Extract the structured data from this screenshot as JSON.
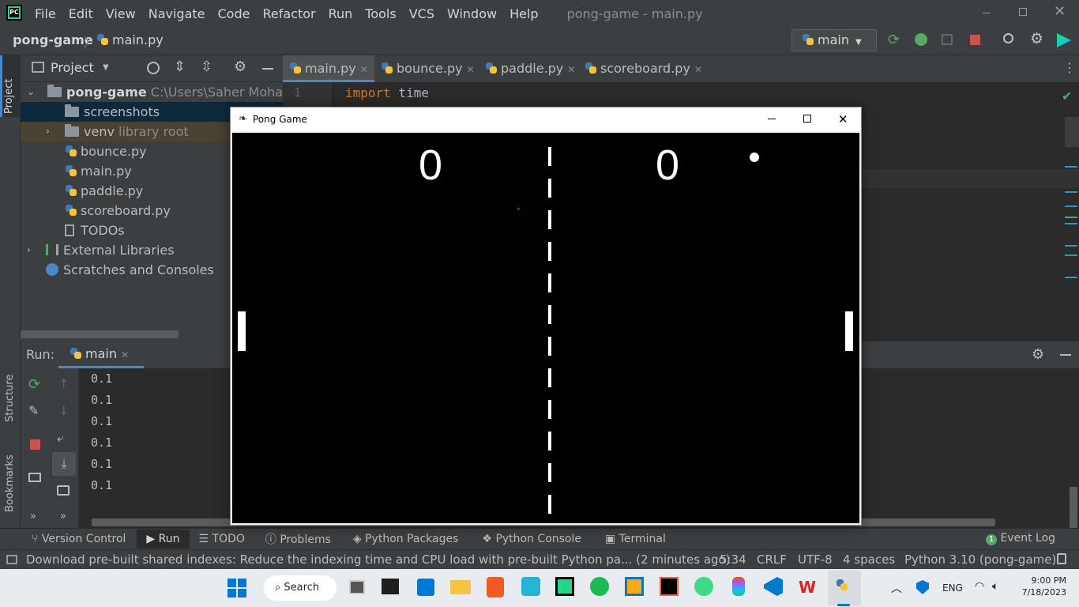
{
  "app": {
    "window_title": "pong-game - main.py",
    "menu": [
      "File",
      "Edit",
      "View",
      "Navigate",
      "Code",
      "Refactor",
      "Run",
      "Tools",
      "VCS",
      "Window",
      "Help"
    ]
  },
  "navbar": {
    "project": "pong-game",
    "file": "main.py",
    "run_config": "main"
  },
  "project_panel": {
    "title": "Project",
    "root_name": "pong-game",
    "root_path": "C:\\Users\\Saher Mohamed",
    "items": [
      {
        "label": "screenshots",
        "suffix": ""
      },
      {
        "label": "venv",
        "suffix": "library root"
      },
      {
        "label": "bounce.py",
        "suffix": ""
      },
      {
        "label": "main.py",
        "suffix": ""
      },
      {
        "label": "paddle.py",
        "suffix": ""
      },
      {
        "label": "scoreboard.py",
        "suffix": ""
      },
      {
        "label": "TODOs",
        "suffix": ""
      },
      {
        "label": "External Libraries",
        "suffix": ""
      },
      {
        "label": "Scratches and Consoles",
        "suffix": ""
      }
    ]
  },
  "side_labels": {
    "project": "Project",
    "structure": "Structure",
    "bookmarks": "Bookmarks"
  },
  "editor": {
    "tabs": [
      "main.py",
      "bounce.py",
      "paddle.py",
      "scoreboard.py"
    ],
    "line_number": "1",
    "code_keyword": "import",
    "code_rest": " time"
  },
  "run_panel": {
    "label": "Run:",
    "tab": "main",
    "output": [
      "0.1",
      "0.1",
      "0.1",
      "0.1",
      "0.1",
      "0.1"
    ]
  },
  "tool_tabs": [
    "Version Control",
    "Run",
    "TODO",
    "Problems",
    "Python Packages",
    "Python Console",
    "Terminal"
  ],
  "event_log": {
    "count": "1",
    "label": "Event Log"
  },
  "status": {
    "message": "Download pre-built shared indexes: Reduce the indexing time and CPU load with pre-built Python pa... (2 minutes ago)",
    "position": "5:34",
    "line_sep": "CRLF",
    "encoding": "UTF-8",
    "indent": "4 spaces",
    "interpreter": "Python 3.10 (pong-game)"
  },
  "pong": {
    "title": "Pong Game",
    "score_left": "0",
    "score_right": "0"
  },
  "taskbar": {
    "search": "Search",
    "lang": "ENG",
    "time": "9:00 PM",
    "date": "7/18/2023"
  }
}
